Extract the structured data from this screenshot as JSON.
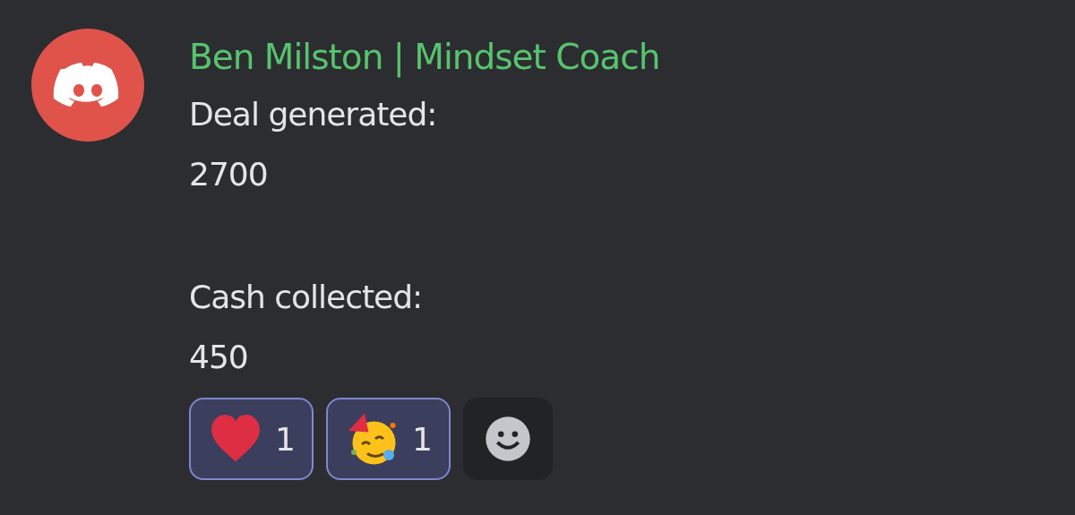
{
  "message": {
    "author": "Ben Milston | Mindset Coach",
    "paragraphs": [
      {
        "lines": [
          "Deal generated:",
          "2700"
        ]
      },
      {
        "lines": [
          "Cash collected:",
          "450"
        ]
      }
    ],
    "reactions": [
      {
        "kind": "heart",
        "count": "1",
        "selected": true
      },
      {
        "kind": "party",
        "count": "1",
        "selected": true
      }
    ]
  }
}
